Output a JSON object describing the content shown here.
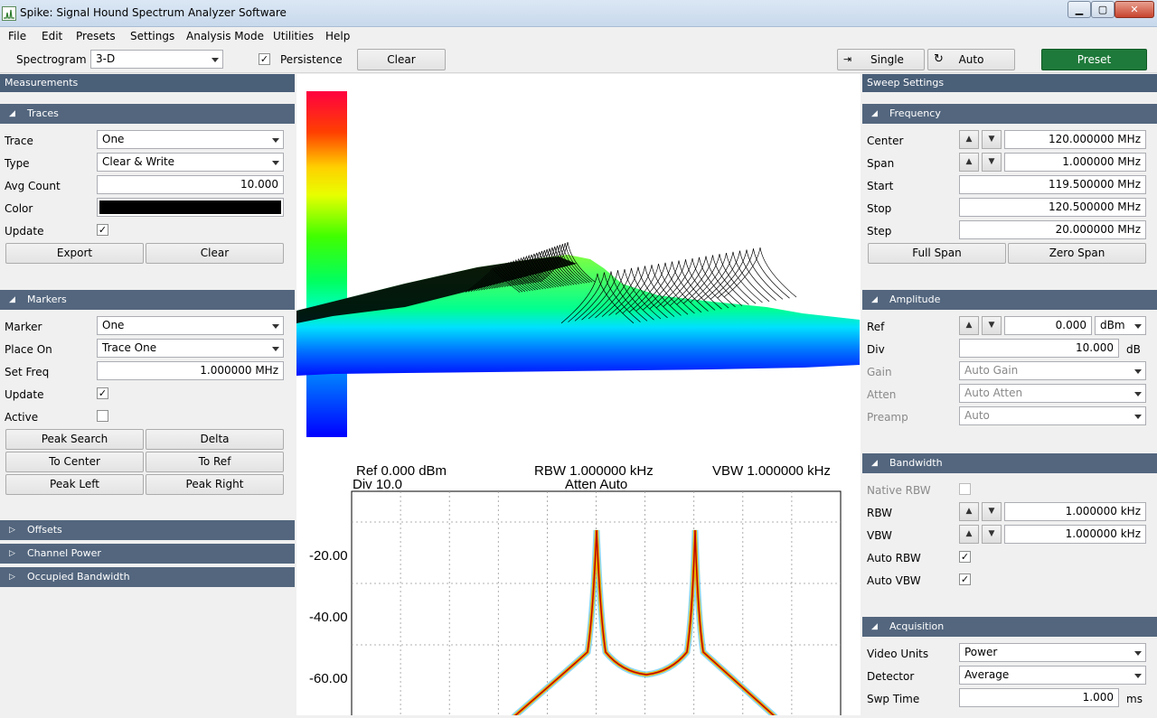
{
  "window": {
    "title": "Spike: Signal Hound Spectrum Analyzer Software"
  },
  "menu": [
    "File",
    "Edit",
    "Presets",
    "Settings",
    "Analysis Mode",
    "Utilities",
    "Help"
  ],
  "toolbar": {
    "spectrogram_label": "Spectrogram",
    "spectrogram_value": "3-D",
    "persistence_label": "Persistence",
    "persistence_checked": true,
    "clear_label": "Clear",
    "single_label": "Single",
    "auto_label": "Auto",
    "preset_label": "Preset"
  },
  "left": {
    "header": "Measurements",
    "traces": {
      "title": "Traces",
      "trace_label": "Trace",
      "trace_value": "One",
      "type_label": "Type",
      "type_value": "Clear & Write",
      "avg_label": "Avg Count",
      "avg_value": "10.000",
      "color_label": "Color",
      "color_value": "#000000",
      "update_label": "Update",
      "export_label": "Export",
      "clear_label": "Clear"
    },
    "markers": {
      "title": "Markers",
      "marker_label": "Marker",
      "marker_value": "One",
      "place_label": "Place On",
      "place_value": "Trace One",
      "setfreq_label": "Set Freq",
      "setfreq_value": "1.000000 MHz",
      "update_label": "Update",
      "active_label": "Active",
      "peak_search": "Peak Search",
      "delta": "Delta",
      "to_center": "To Center",
      "to_ref": "To Ref",
      "peak_left": "Peak Left",
      "peak_right": "Peak Right"
    },
    "collapsed": [
      "Offsets",
      "Channel Power",
      "Occupied Bandwidth"
    ]
  },
  "plot": {
    "ref": "Ref 0.000 dBm",
    "div": "Div 10.0",
    "rbw": "RBW 1.000000 kHz",
    "atten": "Atten Auto",
    "vbw": "VBW 1.000000 kHz",
    "y_ticks": [
      "-20.00",
      "-40.00",
      "-60.00"
    ]
  },
  "right": {
    "header": "Sweep Settings",
    "frequency": {
      "title": "Frequency",
      "center_label": "Center",
      "center_value": "120.000000 MHz",
      "span_label": "Span",
      "span_value": "1.000000 MHz",
      "start_label": "Start",
      "start_value": "119.500000 MHz",
      "stop_label": "Stop",
      "stop_value": "120.500000 MHz",
      "step_label": "Step",
      "step_value": "20.000000 MHz",
      "full_span": "Full Span",
      "zero_span": "Zero Span"
    },
    "amplitude": {
      "title": "Amplitude",
      "ref_label": "Ref",
      "ref_value": "0.000",
      "ref_unit": "dBm",
      "div_label": "Div",
      "div_value": "10.000",
      "div_unit": "dB",
      "gain_label": "Gain",
      "gain_value": "Auto Gain",
      "atten_label": "Atten",
      "atten_value": "Auto Atten",
      "preamp_label": "Preamp",
      "preamp_value": "Auto"
    },
    "bandwidth": {
      "title": "Bandwidth",
      "native_label": "Native RBW",
      "rbw_label": "RBW",
      "rbw_value": "1.000000 kHz",
      "vbw_label": "VBW",
      "vbw_value": "1.000000 kHz",
      "auto_rbw_label": "Auto RBW",
      "auto_vbw_label": "Auto VBW"
    },
    "acquisition": {
      "title": "Acquisition",
      "video_label": "Video Units",
      "video_value": "Power",
      "detector_label": "Detector",
      "detector_value": "Average",
      "swp_label": "Swp Time",
      "swp_value": "1.000",
      "swp_unit": "ms"
    }
  }
}
